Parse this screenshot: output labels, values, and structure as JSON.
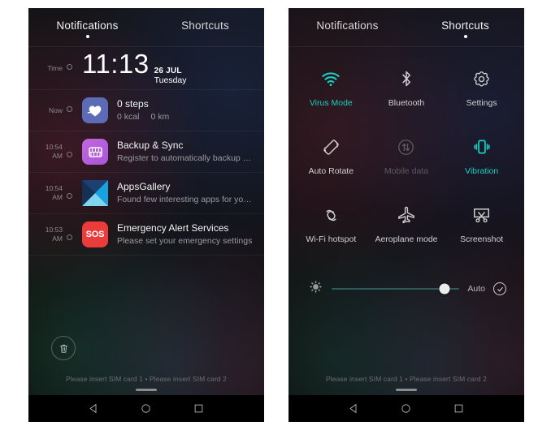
{
  "tabs": {
    "notifications_label": "Notifications",
    "shortcuts_label": "Shortcuts"
  },
  "left_panel": {
    "active_tab": "Notifications",
    "clock": {
      "stamp": "Time",
      "time": "11:13",
      "date": "26 JUL",
      "weekday": "Tuesday"
    },
    "notifications": [
      {
        "stamp": "Now",
        "stamp2": "",
        "icon": "health-icon",
        "title": "0 steps",
        "subtitle_a": "0 kcal",
        "subtitle_b": "0 km"
      },
      {
        "stamp": "10:54",
        "stamp2": "AM",
        "icon": "backup-sync-icon",
        "title": "Backup & Sync",
        "subtitle_a": "Register to automatically backup and sync…",
        "subtitle_b": ""
      },
      {
        "stamp": "10:54",
        "stamp2": "AM",
        "icon": "apps-gallery-icon",
        "title": "AppsGallery",
        "subtitle_a": "Found few interesting apps for you from G…",
        "subtitle_b": ""
      },
      {
        "stamp": "10:53",
        "stamp2": "AM",
        "icon": "sos-icon",
        "title": "Emergency Alert Services",
        "subtitle_a": "Please set your emergency settings",
        "subtitle_b": ""
      }
    ],
    "clear_button": "trash-icon",
    "sim_status": "Please insert SIM card 1 • Please insert SIM card 2"
  },
  "right_panel": {
    "active_tab": "Shortcuts",
    "shortcuts": [
      {
        "label": "Virus Mode",
        "icon": "wifi-icon",
        "state": "on"
      },
      {
        "label": "Bluetooth",
        "icon": "bluetooth-icon",
        "state": "neutral"
      },
      {
        "label": "Settings",
        "icon": "gear-icon",
        "state": "neutral"
      },
      {
        "label": "Auto Rotate",
        "icon": "auto-rotate-icon",
        "state": "neutral"
      },
      {
        "label": "Mobile data",
        "icon": "mobile-data-icon",
        "state": "off"
      },
      {
        "label": "Vibration",
        "icon": "vibration-icon",
        "state": "on"
      },
      {
        "label": "Wi-Fi hotspot",
        "icon": "hotspot-icon",
        "state": "neutral"
      },
      {
        "label": "Aeroplane mode",
        "icon": "aeroplane-icon",
        "state": "neutral"
      },
      {
        "label": "Screenshot",
        "icon": "screenshot-icon",
        "state": "neutral"
      }
    ],
    "brightness": {
      "icon": "brightness-icon",
      "value_percent": 88,
      "auto_label": "Auto",
      "auto_checked": true
    },
    "sim_status": "Please insert SIM card 1 • Please insert SIM card 2"
  },
  "navbar": {
    "back": "back-triangle-icon",
    "home": "home-circle-icon",
    "recents": "recents-square-icon"
  },
  "colors": {
    "accent": "#18cfc0",
    "panel_bg": "#0d0d0f",
    "text_primary": "#f4f4f4",
    "text_secondary": "#9b9b9f",
    "disabled": "#5a5a5e"
  }
}
